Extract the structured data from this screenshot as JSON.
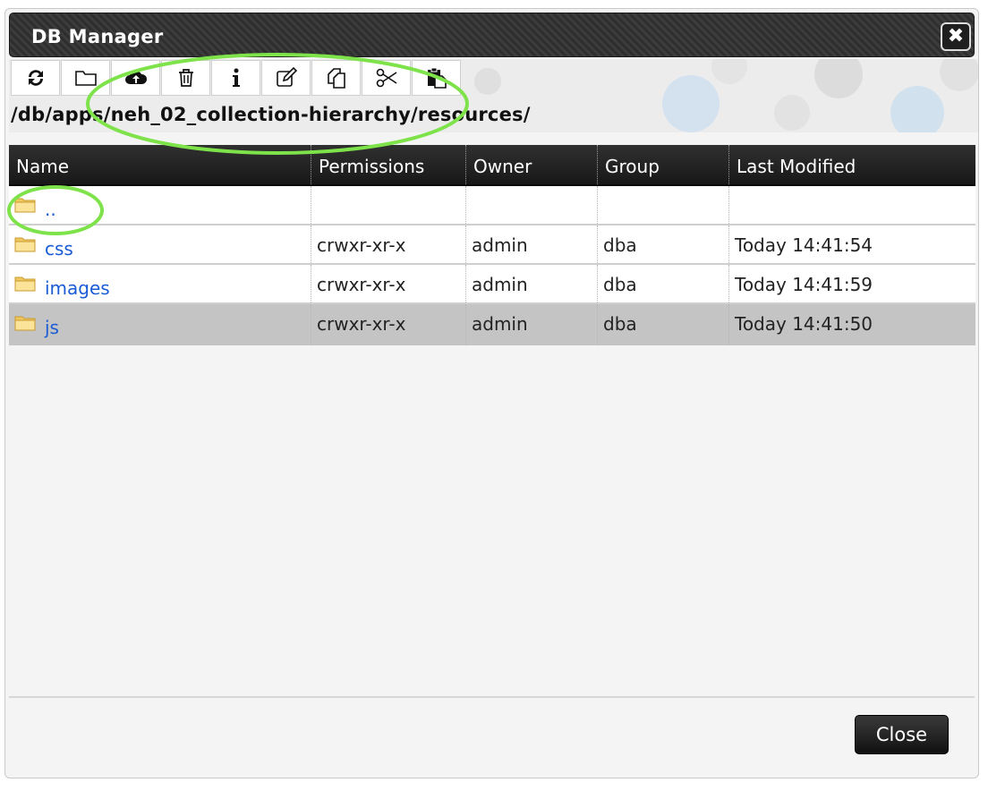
{
  "dialog": {
    "title": "DB Manager",
    "close_icon": "close-icon"
  },
  "toolbar": {
    "buttons": [
      {
        "name": "refresh",
        "icon": "refresh-icon"
      },
      {
        "name": "new-collection",
        "icon": "folder-icon"
      },
      {
        "name": "upload",
        "icon": "cloud-upload-icon"
      },
      {
        "name": "delete",
        "icon": "trash-icon"
      },
      {
        "name": "properties",
        "icon": "info-icon"
      },
      {
        "name": "rename",
        "icon": "edit-icon"
      },
      {
        "name": "copy",
        "icon": "copy-icon"
      },
      {
        "name": "cut",
        "icon": "scissors-icon"
      },
      {
        "name": "paste",
        "icon": "paste-icon"
      }
    ],
    "path": "/db/apps/neh_02_collection-hierarchy/resources/"
  },
  "table": {
    "columns": [
      "Name",
      "Permissions",
      "Owner",
      "Group",
      "Last Modified"
    ],
    "rows": [
      {
        "name": "..",
        "permissions": "",
        "owner": "",
        "group": "",
        "modified": ""
      },
      {
        "name": "css",
        "permissions": "crwxr-xr-x",
        "owner": "admin",
        "group": "dba",
        "modified": "Today 14:41:54"
      },
      {
        "name": "images",
        "permissions": "crwxr-xr-x",
        "owner": "admin",
        "group": "dba",
        "modified": "Today 14:41:59"
      },
      {
        "name": "js",
        "permissions": "crwxr-xr-x",
        "owner": "admin",
        "group": "dba",
        "modified": "Today 14:41:50"
      }
    ],
    "selected_row": "js"
  },
  "footer": {
    "close_label": "Close"
  },
  "colors": {
    "link": "#1a5bd6",
    "highlight": "#7ee34a",
    "selected_row": "#c4c4c4"
  }
}
